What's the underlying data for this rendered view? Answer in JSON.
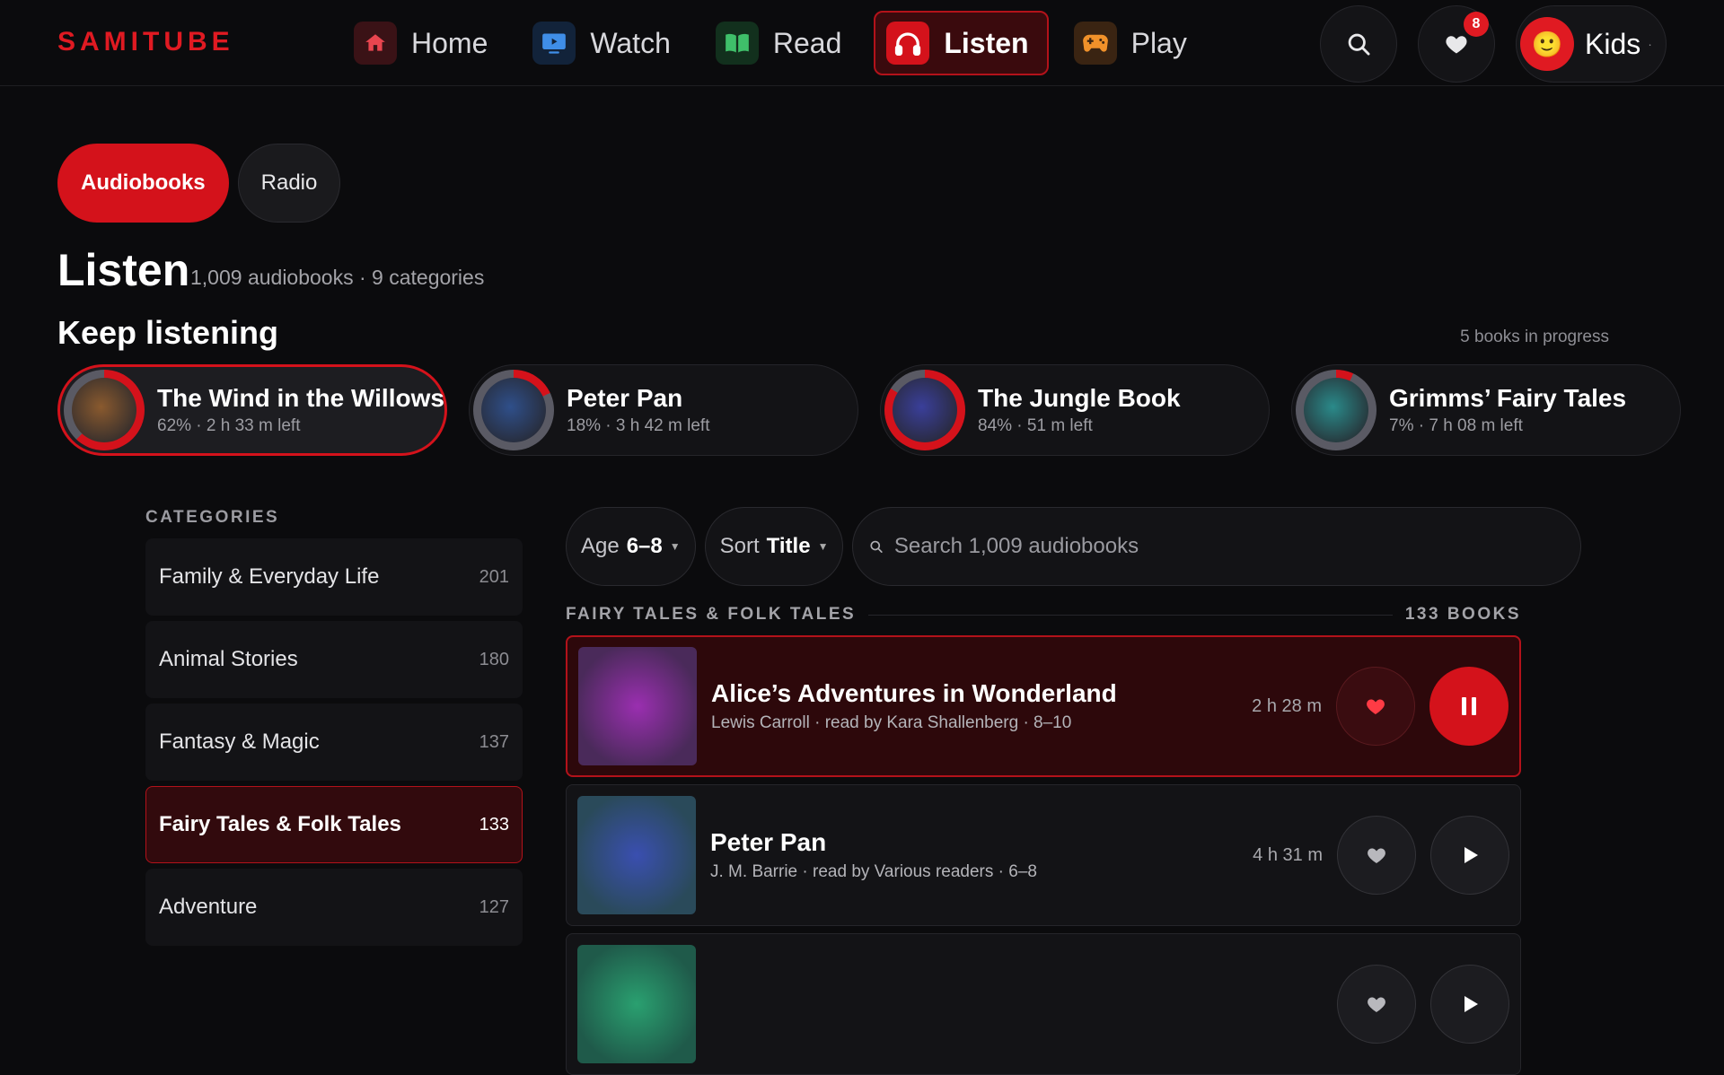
{
  "brand": "SAMITUBE",
  "nav": [
    {
      "label": "Home",
      "icon": "home-icon",
      "color": "#e8454f",
      "bg": "#3a1216"
    },
    {
      "label": "Watch",
      "icon": "tv-icon",
      "color": "#3f8ee8",
      "bg": "#12233a"
    },
    {
      "label": "Read",
      "icon": "book-icon",
      "color": "#3fbf6a",
      "bg": "#12301d"
    },
    {
      "label": "Listen",
      "icon": "headphones-icon",
      "color": "#ffffff",
      "bg": "#d4121b",
      "active": true
    },
    {
      "label": "Play",
      "icon": "gamepad-icon",
      "color": "#f0912a",
      "bg": "#3a2412"
    }
  ],
  "header": {
    "favorites_badge": "8",
    "profile_name": "Kids",
    "profile_dot": "·"
  },
  "tabs": [
    {
      "label": "Audiobooks",
      "active": true
    },
    {
      "label": "Radio",
      "active": false
    }
  ],
  "page": {
    "title": "Listen",
    "meta": "1,009 audiobooks · 9 categories"
  },
  "keep_listening": {
    "title": "Keep listening",
    "meta": "5 books in progress",
    "items": [
      {
        "title": "The Wind in the Willows",
        "sub": "62% · 2 h 33 m left",
        "progress": 62,
        "cover": "#8a5a2e",
        "active": true
      },
      {
        "title": "Peter Pan",
        "sub": "18% · 3 h 42 m left",
        "progress": 18,
        "cover": "#2f4f8a",
        "active": false
      },
      {
        "title": "The Jungle Book",
        "sub": "84% · 51 m left",
        "progress": 84,
        "cover": "#3a3f9a",
        "active": false
      },
      {
        "title": "Grimms’ Fairy Tales",
        "sub": "7% · 7 h 08 m left",
        "progress": 7,
        "cover": "#2a8a8a",
        "active": false
      }
    ]
  },
  "categories": {
    "header": "CATEGORIES",
    "items": [
      {
        "name": "Family & Everyday Life",
        "count": "201"
      },
      {
        "name": "Animal Stories",
        "count": "180"
      },
      {
        "name": "Fantasy & Magic",
        "count": "137"
      },
      {
        "name": "Fairy Tales & Folk Tales",
        "count": "133",
        "active": true
      },
      {
        "name": "Adventure",
        "count": "127"
      }
    ]
  },
  "filters": {
    "age_label": "Age",
    "age_value": "6–8",
    "sort_label": "Sort",
    "sort_value": "Title",
    "search_placeholder": "Search 1,009 audiobooks"
  },
  "group": {
    "title": "FAIRY TALES & FOLK TALES",
    "count": "133 BOOKS"
  },
  "books": [
    {
      "title": "Alice’s Adventures in Wonderland",
      "sub": "Lewis Carroll · read by Kara Shallenberg · 8–10",
      "duration": "2 h 28 m",
      "cover": "#9a2fb0",
      "cover_bg": "#4a2a5a",
      "active": true,
      "playing": true
    },
    {
      "title": "Peter Pan",
      "sub": "J. M. Barrie · read by Various readers · 6–8",
      "duration": "4 h 31 m",
      "cover": "#3a4fb0",
      "cover_bg": "#2a4a5a",
      "active": false,
      "playing": false
    },
    {
      "title": "",
      "sub": "",
      "duration": "",
      "cover": "#2aa070",
      "cover_bg": "#1f5a4a",
      "active": false,
      "playing": false
    }
  ]
}
